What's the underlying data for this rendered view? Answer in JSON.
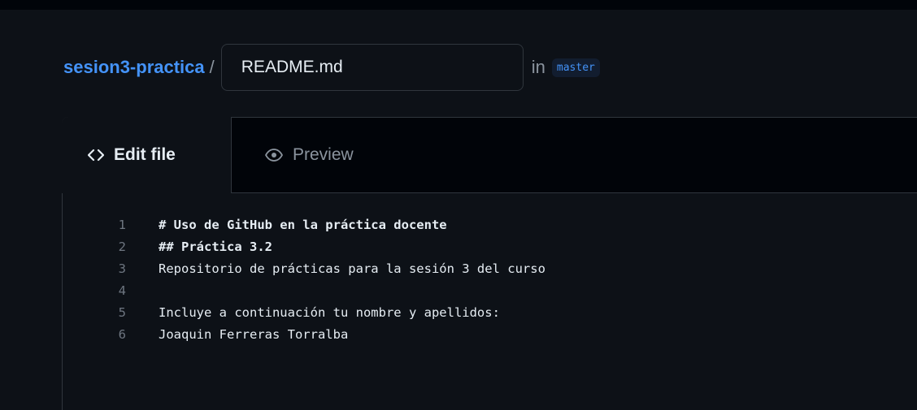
{
  "breadcrumb": {
    "repo_name": "sesion3-practica",
    "separator": "/",
    "in_label": "in",
    "branch": "master"
  },
  "filename_input": {
    "value": "README.md"
  },
  "tabs": [
    {
      "label": "Edit file",
      "icon": "code-icon",
      "active": true
    },
    {
      "label": "Preview",
      "icon": "eye-icon",
      "active": false
    }
  ],
  "code_lines": [
    {
      "number": "1",
      "text": "# Uso de GitHub en la práctica docente",
      "heading": true
    },
    {
      "number": "2",
      "text": "## Práctica 3.2",
      "heading": true
    },
    {
      "number": "3",
      "text": "Repositorio de prácticas para la sesión 3 del curso",
      "heading": false
    },
    {
      "number": "4",
      "text": "",
      "heading": false
    },
    {
      "number": "5",
      "text": "Incluye a continuación tu nombre y apellidos:",
      "heading": false
    },
    {
      "number": "6",
      "text": "Joaquin Ferreras Torralba",
      "heading": false
    }
  ]
}
